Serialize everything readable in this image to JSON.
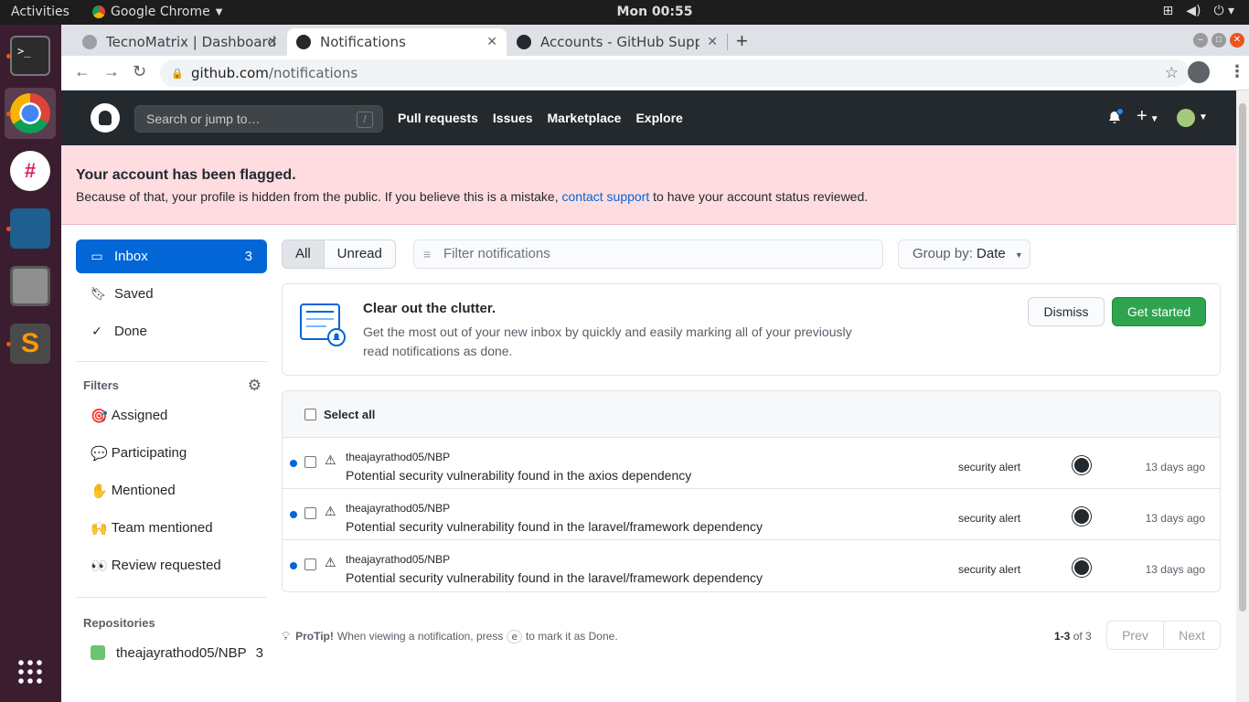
{
  "os": {
    "activities": "Activities",
    "app_menu": "Google Chrome",
    "clock": "Mon 00:55"
  },
  "browser": {
    "tabs": [
      {
        "title": "TecnoMatrix | Dashboard",
        "active": false
      },
      {
        "title": "Notifications",
        "active": true
      },
      {
        "title": "Accounts - GitHub Support",
        "active": false
      }
    ],
    "url_host": "github.com",
    "url_path": "/notifications"
  },
  "gh_header": {
    "search_placeholder": "Search or jump to…",
    "search_key": "/",
    "nav": [
      "Pull requests",
      "Issues",
      "Marketplace",
      "Explore"
    ]
  },
  "flash": {
    "heading": "Your account has been flagged.",
    "text_before": "Because of that, your profile is hidden from the public. If you believe this is a mistake, ",
    "link": "contact support",
    "text_after": " to have your account status reviewed."
  },
  "sidebar": {
    "items": [
      {
        "label": "Inbox",
        "count": "3",
        "icon": "inbox-icon"
      },
      {
        "label": "Saved",
        "icon": "bookmark-icon"
      },
      {
        "label": "Done",
        "icon": "check-icon"
      }
    ],
    "filters_title": "Filters",
    "filters": [
      {
        "emoji": "🎯",
        "label": "Assigned"
      },
      {
        "emoji": "💬",
        "label": "Participating"
      },
      {
        "emoji": "✋",
        "label": "Mentioned"
      },
      {
        "emoji": "🙌",
        "label": "Team mentioned"
      },
      {
        "emoji": "👀",
        "label": "Review requested"
      }
    ],
    "repos_title": "Repositories",
    "repos": [
      {
        "name": "theajayrathod05/NBP",
        "count": "3"
      }
    ]
  },
  "main": {
    "seg_all": "All",
    "seg_unread": "Unread",
    "filter_placeholder": "Filter notifications",
    "groupby_label": "Group by:",
    "groupby_value": "Date",
    "promo": {
      "title": "Clear out the clutter.",
      "desc": "Get the most out of your new inbox by quickly and easily marking all of your previously read notifications as done.",
      "dismiss": "Dismiss",
      "start": "Get started"
    },
    "select_all": "Select all",
    "notifications": [
      {
        "repo": "theajayrathod05/NBP",
        "title": "Potential security vulnerability found in the axios dependency",
        "reason": "security alert",
        "ago": "13 days ago"
      },
      {
        "repo": "theajayrathod05/NBP",
        "title": "Potential security vulnerability found in the laravel/framework dependency",
        "reason": "security alert",
        "ago": "13 days ago"
      },
      {
        "repo": "theajayrathod05/NBP",
        "title": "Potential security vulnerability found in the laravel/framework dependency",
        "reason": "security alert",
        "ago": "13 days ago"
      }
    ],
    "protip_label": "ProTip!",
    "protip_before": "When viewing a notification, press",
    "protip_key": "e",
    "protip_after": "to mark it as Done.",
    "pager_range": "1-3",
    "pager_of": "of 3",
    "prev": "Prev",
    "next": "Next"
  },
  "colors": {
    "accent": "#0366d6",
    "flash_bg": "#ffdce0",
    "header_bg": "#24292e",
    "success": "#2ea44f"
  }
}
